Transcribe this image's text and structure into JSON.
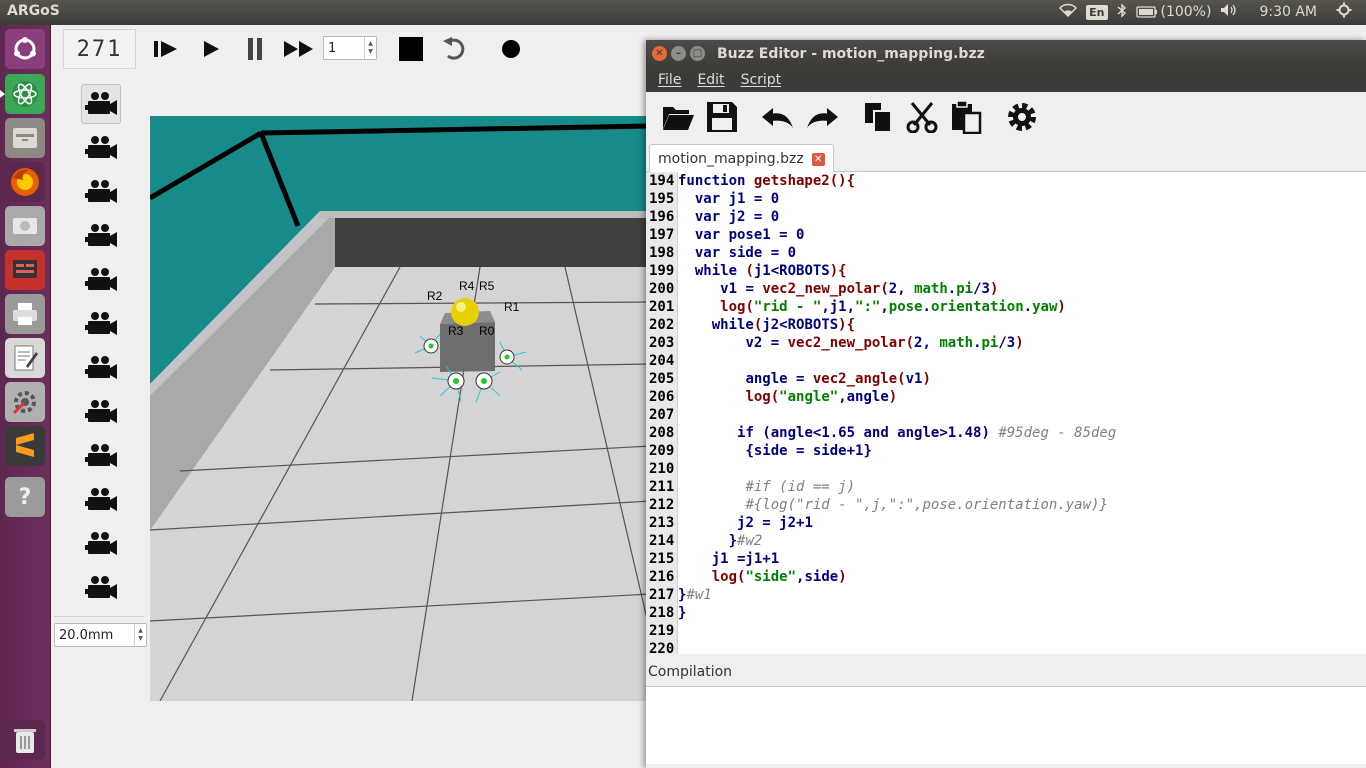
{
  "topbar": {
    "app_title": "ARGoS",
    "lang": "En",
    "battery": "(100%)",
    "time": "9:30 AM"
  },
  "argos": {
    "step_counter": "271",
    "speed_value": "1",
    "zoom_value": "20.0mm",
    "robot_labels": [
      "R2",
      "R4",
      "R5",
      "R1",
      "R3",
      "R0"
    ]
  },
  "editor": {
    "window_title": "Buzz Editor - motion_mapping.bzz",
    "menu": [
      "File",
      "Edit",
      "Script"
    ],
    "tab_label": "motion_mapping.bzz",
    "compilation_label": "Compilation",
    "code_lines": [
      {
        "n": "194",
        "tokens": [
          [
            "kw",
            "function "
          ],
          [
            "fn",
            "getshape2"
          ],
          [
            "fn",
            "(){"
          ]
        ]
      },
      {
        "n": "195",
        "tokens": [
          [
            "pl",
            "  "
          ],
          [
            "kw",
            "var "
          ],
          [
            "kw",
            "j1 = 0"
          ]
        ]
      },
      {
        "n": "196",
        "tokens": [
          [
            "pl",
            "  "
          ],
          [
            "kw",
            "var "
          ],
          [
            "kw",
            "j2 = 0"
          ]
        ]
      },
      {
        "n": "197",
        "tokens": [
          [
            "pl",
            "  "
          ],
          [
            "kw",
            "var "
          ],
          [
            "kw",
            "pose1 = 0"
          ]
        ]
      },
      {
        "n": "198",
        "tokens": [
          [
            "pl",
            "  "
          ],
          [
            "kw",
            "var "
          ],
          [
            "kw",
            "side = 0"
          ]
        ]
      },
      {
        "n": "199",
        "tokens": [
          [
            "pl",
            "  "
          ],
          [
            "kw",
            "while "
          ],
          [
            "fn",
            "("
          ],
          [
            "kw",
            "j1<ROBOTS"
          ],
          [
            "fn",
            "){"
          ]
        ]
      },
      {
        "n": "200",
        "tokens": [
          [
            "pl",
            "     "
          ],
          [
            "kw",
            "v1 = "
          ],
          [
            "fn",
            "vec2_new_polar"
          ],
          [
            "fn",
            "("
          ],
          [
            "kw",
            "2, "
          ],
          [
            "str",
            "math"
          ],
          [
            "kw",
            "."
          ],
          [
            "str",
            "pi"
          ],
          [
            "kw",
            "/3"
          ],
          [
            "fn",
            ")"
          ]
        ]
      },
      {
        "n": "201",
        "tokens": [
          [
            "pl",
            "     "
          ],
          [
            "fn",
            "log"
          ],
          [
            "fn",
            "("
          ],
          [
            "str",
            "\"rid - \""
          ],
          [
            "kw",
            ",j1,"
          ],
          [
            "str",
            "\":\""
          ],
          [
            "kw",
            ","
          ],
          [
            "str",
            "pose"
          ],
          [
            "kw",
            "."
          ],
          [
            "str",
            "orientation"
          ],
          [
            "kw",
            "."
          ],
          [
            "str",
            "yaw"
          ],
          [
            "fn",
            ")"
          ]
        ]
      },
      {
        "n": "202",
        "tokens": [
          [
            "pl",
            "    "
          ],
          [
            "kw",
            "while"
          ],
          [
            "fn",
            "("
          ],
          [
            "kw",
            "j2<ROBOTS"
          ],
          [
            "fn",
            "){"
          ]
        ]
      },
      {
        "n": "203",
        "tokens": [
          [
            "pl",
            "        "
          ],
          [
            "kw",
            "v2 = "
          ],
          [
            "fn",
            "vec2_new_polar"
          ],
          [
            "fn",
            "("
          ],
          [
            "kw",
            "2, "
          ],
          [
            "str",
            "math"
          ],
          [
            "kw",
            "."
          ],
          [
            "str",
            "pi"
          ],
          [
            "kw",
            "/3"
          ],
          [
            "fn",
            ")"
          ]
        ]
      },
      {
        "n": "204",
        "tokens": []
      },
      {
        "n": "205",
        "tokens": [
          [
            "pl",
            "        "
          ],
          [
            "kw",
            "angle = "
          ],
          [
            "fn",
            "vec2_angle"
          ],
          [
            "fn",
            "("
          ],
          [
            "kw",
            "v1"
          ],
          [
            "fn",
            ")"
          ]
        ]
      },
      {
        "n": "206",
        "tokens": [
          [
            "pl",
            "        "
          ],
          [
            "fn",
            "log"
          ],
          [
            "fn",
            "("
          ],
          [
            "str",
            "\"angle\""
          ],
          [
            "kw",
            ",angle"
          ],
          [
            "fn",
            ")"
          ]
        ]
      },
      {
        "n": "207",
        "tokens": []
      },
      {
        "n": "208",
        "tokens": [
          [
            "pl",
            "       "
          ],
          [
            "kw",
            "if "
          ],
          [
            "kw",
            "(angle<1.65 and angle>1.48) "
          ],
          [
            "cm",
            "#95deg - 85deg"
          ]
        ]
      },
      {
        "n": "209",
        "tokens": [
          [
            "pl",
            "        "
          ],
          [
            "kw",
            "{side = side+1}"
          ]
        ]
      },
      {
        "n": "210",
        "tokens": []
      },
      {
        "n": "211",
        "tokens": [
          [
            "pl",
            "        "
          ],
          [
            "cm",
            "#if (id == j)"
          ]
        ]
      },
      {
        "n": "212",
        "tokens": [
          [
            "pl",
            "        "
          ],
          [
            "cm",
            "#{log(\"rid - \",j,\":\",pose.orientation.yaw)}"
          ]
        ]
      },
      {
        "n": "213",
        "tokens": [
          [
            "pl",
            "       "
          ],
          [
            "kw",
            "j2 = j2+1"
          ]
        ]
      },
      {
        "n": "214",
        "tokens": [
          [
            "pl",
            "      "
          ],
          [
            "kw",
            "}"
          ],
          [
            "cm",
            "#w2"
          ]
        ]
      },
      {
        "n": "215",
        "tokens": [
          [
            "pl",
            "    "
          ],
          [
            "kw",
            "j1 =j1+1"
          ]
        ]
      },
      {
        "n": "216",
        "tokens": [
          [
            "pl",
            "    "
          ],
          [
            "fn",
            "log"
          ],
          [
            "fn",
            "("
          ],
          [
            "str",
            "\"side\""
          ],
          [
            "kw",
            ",side"
          ],
          [
            "fn",
            ")"
          ]
        ]
      },
      {
        "n": "217",
        "tokens": [
          [
            "kw",
            "}"
          ],
          [
            "cm",
            "#w1"
          ]
        ]
      },
      {
        "n": "218",
        "tokens": [
          [
            "kw",
            "}"
          ]
        ]
      },
      {
        "n": "219",
        "tokens": []
      },
      {
        "n": "220",
        "tokens": []
      }
    ]
  }
}
